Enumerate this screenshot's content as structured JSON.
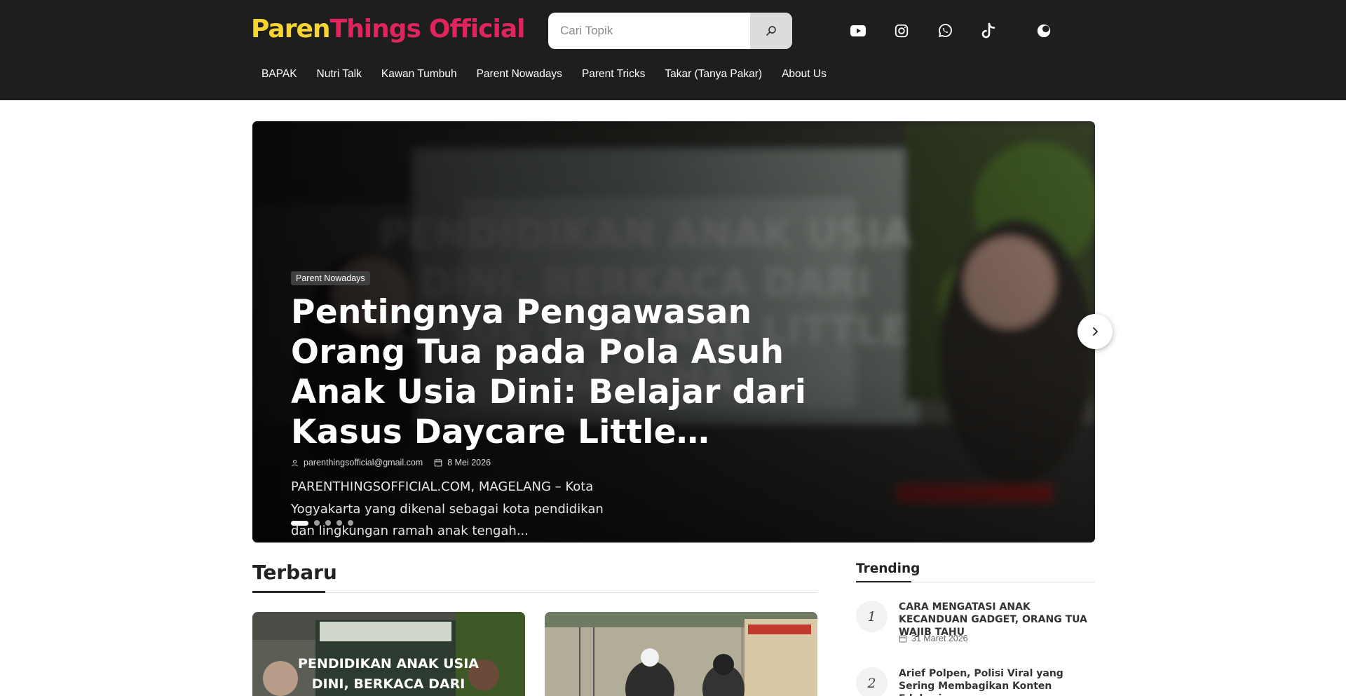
{
  "brand": {
    "logo_part1": "Paren",
    "logo_part2": "Things",
    "logo_part3": "Official"
  },
  "search": {
    "placeholder": "Cari Topik"
  },
  "social_icons": [
    "youtube-icon",
    "instagram-icon",
    "whatsapp-icon",
    "tiktok-icon",
    "dark-mode-toggle-icon"
  ],
  "nav": {
    "items": [
      "BAPAK",
      "Nutri Talk",
      "Kawan Tumbuh",
      "Parent Nowadays",
      "Parent Tricks",
      "Takar (Tanya Pakar)",
      "About Us"
    ]
  },
  "hero": {
    "category": "Parent Nowadays",
    "title": "Pentingnya Pengawasan Orang Tua pada Pola Asuh Anak Usia Dini: Belajar dari Kasus Daycare Little…",
    "author": "parenthingsofficial@gmail.com",
    "date": "8 Mei 2026",
    "excerpt": "PARENTHINGSOFFICIAL.COM, MAGELANG – Kota Yogyakarta yang dikenal sebagai kota pendidikan dan lingkungan ramah anak tengah...",
    "slide_count": 5,
    "active_slide": 1,
    "image_text_line1": "PENDIDIKAN ANAK USIA",
    "image_text_line2": "DINI, BERKACA DARI",
    "image_text_line3": "KASUS DAYCARE LITTLE",
    "image_text_line4": "ARESHA"
  },
  "latest": {
    "heading": "Terbaru",
    "card1_text_line1": "PENDIDIKAN ANAK USIA",
    "card1_text_line2": "DINI, BERKACA DARI"
  },
  "trending": {
    "heading": "Trending",
    "items": [
      {
        "rank": "1",
        "title": "CARA MENGATASI ANAK KECANDUAN GADGET, ORANG TUA WAJIB TAHU",
        "date": "31 Maret 2026"
      },
      {
        "rank": "2",
        "title": "Arief Polpen, Polisi Viral yang Sering Membagikan Konten Edukasi…"
      }
    ]
  },
  "colors": {
    "header_bg": "#1e1e1e",
    "logo_yellow": "#f6d431",
    "logo_pink": "#e0245e",
    "logo_blue": "#2f9bd8"
  }
}
